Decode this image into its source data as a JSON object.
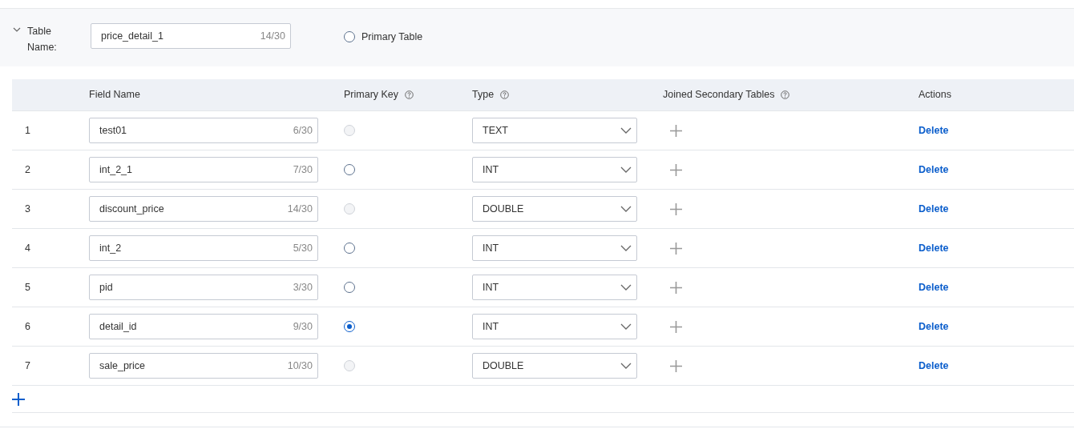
{
  "table_name": {
    "label": "Table Name:",
    "expanded": true,
    "value": "price_detail_1",
    "counter": "14/30"
  },
  "primary_table": {
    "label": "Primary Table",
    "selected": false
  },
  "columns": [
    {
      "label": "Field Name",
      "help": false
    },
    {
      "label": "Primary Key",
      "help": true
    },
    {
      "label": "Type",
      "help": true
    },
    {
      "label": "Joined Secondary Tables",
      "help": true
    },
    {
      "label": "Actions",
      "help": false
    }
  ],
  "rows": [
    {
      "index": "1",
      "field_name": "test01",
      "counter": "6/30",
      "primary_key": {
        "selected": false,
        "disabled": true
      },
      "type": "TEXT",
      "action": "Delete"
    },
    {
      "index": "2",
      "field_name": "int_2_1",
      "counter": "7/30",
      "primary_key": {
        "selected": false,
        "disabled": false
      },
      "type": "INT",
      "action": "Delete"
    },
    {
      "index": "3",
      "field_name": "discount_price",
      "counter": "14/30",
      "primary_key": {
        "selected": false,
        "disabled": true
      },
      "type": "DOUBLE",
      "action": "Delete"
    },
    {
      "index": "4",
      "field_name": "int_2",
      "counter": "5/30",
      "primary_key": {
        "selected": false,
        "disabled": false
      },
      "type": "INT",
      "action": "Delete"
    },
    {
      "index": "5",
      "field_name": "pid",
      "counter": "3/30",
      "primary_key": {
        "selected": false,
        "disabled": false
      },
      "type": "INT",
      "action": "Delete"
    },
    {
      "index": "6",
      "field_name": "detail_id",
      "counter": "9/30",
      "primary_key": {
        "selected": true,
        "disabled": false
      },
      "type": "INT",
      "action": "Delete"
    },
    {
      "index": "7",
      "field_name": "sale_price",
      "counter": "10/30",
      "primary_key": {
        "selected": false,
        "disabled": true
      },
      "type": "DOUBLE",
      "action": "Delete"
    }
  ]
}
